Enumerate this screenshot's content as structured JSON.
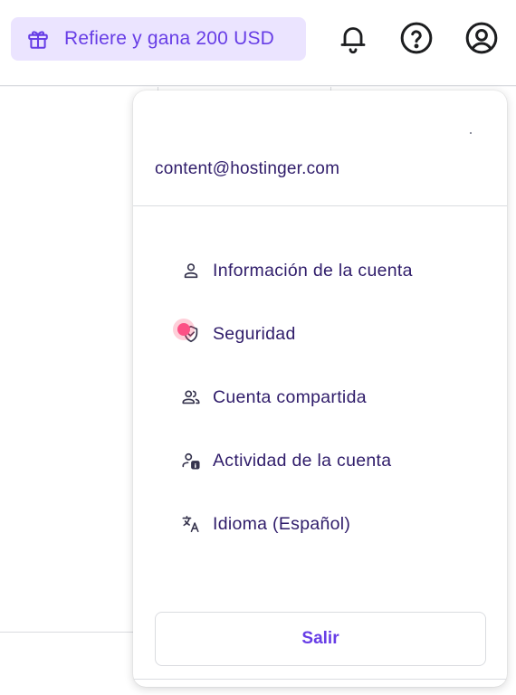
{
  "header": {
    "refer_label": "Refiere y gana 200 USD",
    "icons": [
      "gift-icon",
      "bell-icon",
      "help-icon",
      "user-account-icon"
    ]
  },
  "account_menu": {
    "email": "content@hostinger.com",
    "items": [
      {
        "label": "Información de la cuenta",
        "icon": "user-icon"
      },
      {
        "label": "Seguridad",
        "icon": "shield-check-icon"
      },
      {
        "label": "Cuenta compartida",
        "icon": "users-icon"
      },
      {
        "label": "Actividad de la cuenta",
        "icon": "user-info-icon"
      },
      {
        "label": "Idioma (Español)",
        "icon": "translate-icon"
      }
    ],
    "logout_label": "Salir"
  },
  "colors": {
    "brand": "#673de6",
    "brand_light": "#ebe4ff",
    "text": "#2f1c6a",
    "click_marker": "#fc5185"
  }
}
